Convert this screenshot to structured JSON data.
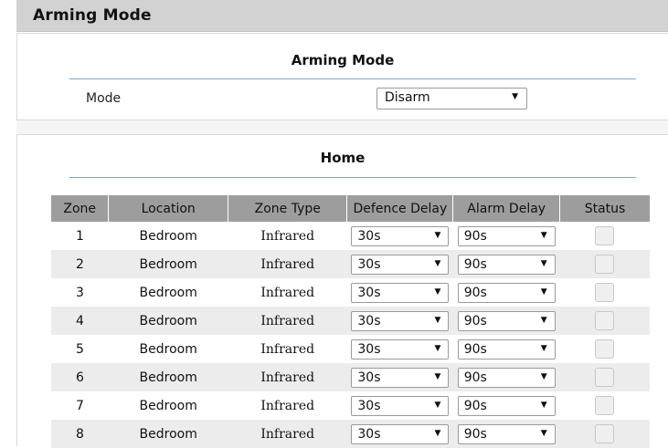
{
  "header": {
    "title": "Arming Mode"
  },
  "arming": {
    "section_title": "Arming Mode",
    "mode_label": "Mode",
    "mode_value": "Disarm"
  },
  "home": {
    "section_title": "Home",
    "columns": [
      "Zone",
      "Location",
      "Zone Type",
      "Defence Delay",
      "Alarm Delay",
      "Status"
    ],
    "rows": [
      {
        "zone": "1",
        "location": "Bedroom",
        "zone_type": "Infrared",
        "defence_delay": "30s",
        "alarm_delay": "90s"
      },
      {
        "zone": "2",
        "location": "Bedroom",
        "zone_type": "Infrared",
        "defence_delay": "30s",
        "alarm_delay": "90s"
      },
      {
        "zone": "3",
        "location": "Bedroom",
        "zone_type": "Infrared",
        "defence_delay": "30s",
        "alarm_delay": "90s"
      },
      {
        "zone": "4",
        "location": "Bedroom",
        "zone_type": "Infrared",
        "defence_delay": "30s",
        "alarm_delay": "90s"
      },
      {
        "zone": "5",
        "location": "Bedroom",
        "zone_type": "Infrared",
        "defence_delay": "30s",
        "alarm_delay": "90s"
      },
      {
        "zone": "6",
        "location": "Bedroom",
        "zone_type": "Infrared",
        "defence_delay": "30s",
        "alarm_delay": "90s"
      },
      {
        "zone": "7",
        "location": "Bedroom",
        "zone_type": "Infrared",
        "defence_delay": "30s",
        "alarm_delay": "90s"
      },
      {
        "zone": "8",
        "location": "Bedroom",
        "zone_type": "Infrared",
        "defence_delay": "30s",
        "alarm_delay": "90s"
      }
    ]
  },
  "icons": {
    "dropdown": "triangle-down-icon",
    "status": "checkbox"
  },
  "colors": {
    "header_bg": "#d2d2d2",
    "table_header_bg": "#9d9d9d",
    "rule": "#7aa7cf",
    "alt_row": "#ececec"
  }
}
